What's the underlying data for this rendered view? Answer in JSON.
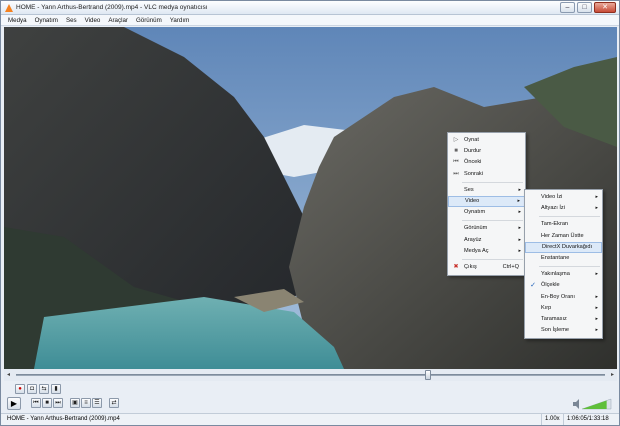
{
  "window": {
    "title": "HOME - Yann Arthus-Bertrand (2009).mp4 - VLC medya oynatıcısı",
    "controls": {
      "minimize": "–",
      "maximize": "□",
      "close": "✕"
    }
  },
  "menubar": [
    "Medya",
    "Oynatım",
    "Ses",
    "Video",
    "Araçlar",
    "Görünüm",
    "Yardım"
  ],
  "context_menu": {
    "items": [
      {
        "label": "Oynat",
        "icon": "play-icon",
        "glyph": "▷"
      },
      {
        "label": "Durdur",
        "icon": "stop-icon",
        "glyph": "■"
      },
      {
        "label": "Önceki",
        "icon": "previous-icon",
        "glyph": "⏮"
      },
      {
        "label": "Sonraki",
        "icon": "next-icon",
        "glyph": "⏭"
      },
      {
        "label": "Ses"
      },
      {
        "label": "Video"
      },
      {
        "label": "Oynatım"
      },
      {
        "label": "Görünüm"
      },
      {
        "label": "Arayüz"
      },
      {
        "label": "Medya Aç"
      },
      {
        "label": "Çıkış",
        "icon": "exit-icon",
        "glyph": "✖",
        "shortcut": "Ctrl+Q"
      }
    ]
  },
  "video_submenu": {
    "items": [
      {
        "label": "Video İzi"
      },
      {
        "label": "Altyazı İzi"
      },
      {
        "label": "Tam-Ekran"
      },
      {
        "label": "Her Zaman Üstte"
      },
      {
        "label": "DirectX Duvarkağıdı"
      },
      {
        "label": "Enstantane"
      },
      {
        "label": "Yakınlaşma"
      },
      {
        "label": "Ölçekle"
      },
      {
        "label": "En-Boy Oranı"
      },
      {
        "label": "Kırp"
      },
      {
        "label": "Taramasız"
      },
      {
        "label": "Son İşleme"
      }
    ]
  },
  "glyphs": {
    "submenu_arrow": "▸",
    "check": "✓"
  },
  "colors": {
    "highlight": "#dce9f8",
    "check": "#1c5fb8",
    "exit": "#c8302a"
  },
  "playback": {
    "progress": 0.7
  },
  "controls": {
    "play": "▶",
    "row1": [
      {
        "name": "record-button",
        "glyph": "●"
      },
      {
        "name": "snapshot-button",
        "glyph": "◘"
      },
      {
        "name": "loop-ab-button",
        "glyph": "⇆"
      },
      {
        "name": "frame-step-button",
        "glyph": "▮"
      }
    ],
    "row2": [
      {
        "name": "previous-button",
        "glyph": "⏮"
      },
      {
        "name": "stop-button",
        "glyph": "■"
      },
      {
        "name": "next-button",
        "glyph": "⏭"
      },
      {
        "name": "fullscreen-button",
        "glyph": "▣"
      },
      {
        "name": "extended-settings-button",
        "glyph": "≡"
      },
      {
        "name": "playlist-button",
        "glyph": "☰"
      },
      {
        "name": "random-button",
        "glyph": "⇄"
      }
    ]
  },
  "volume": {
    "level": 0.85,
    "icon": "speaker-icon"
  },
  "statusbar": {
    "title": "HOME - Yann Arthus-Bertrand (2009).mp4",
    "speed": "1.00x",
    "time": "1:06:05/1:33:18"
  }
}
